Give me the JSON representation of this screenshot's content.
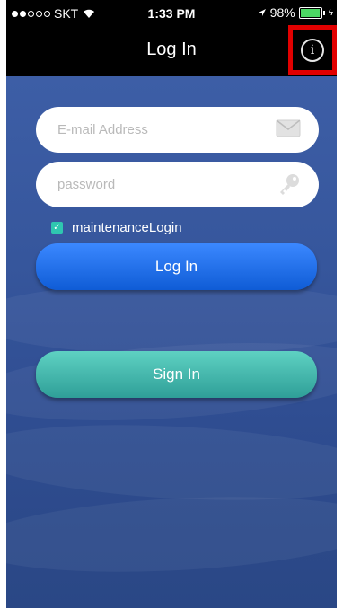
{
  "status": {
    "carrier": "SKT",
    "time": "1:33 PM",
    "battery": "98%",
    "battery_level": 0.98
  },
  "nav": {
    "title": "Log In",
    "info_symbol": "i"
  },
  "form": {
    "email_placeholder": "E-mail Address",
    "password_placeholder": "password",
    "maintenance_label": "maintenanceLogin",
    "maintenance_checked": true
  },
  "buttons": {
    "login": "Log In",
    "signin": "Sign In"
  },
  "colors": {
    "accent_login": "#1565e0",
    "accent_signin": "#3fb4aa",
    "highlight": "#e10000"
  }
}
